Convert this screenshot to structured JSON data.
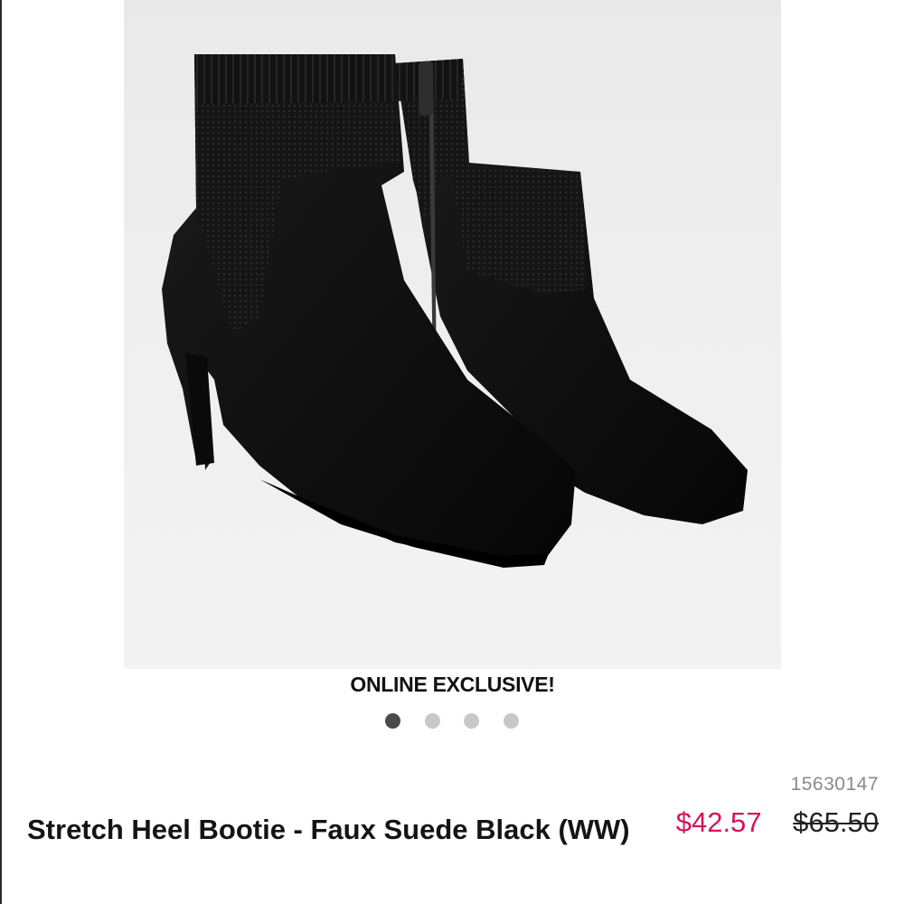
{
  "product": {
    "badge": "ONLINE EXCLUSIVE!",
    "sku": "15630147",
    "title": "Stretch Heel Bootie - Faux Suede Black (WW)",
    "sale_price": "$42.57",
    "original_price": "$65.50",
    "sale_color": "#d2145a"
  },
  "carousel": {
    "dot_count": 4,
    "active_index": 0
  }
}
